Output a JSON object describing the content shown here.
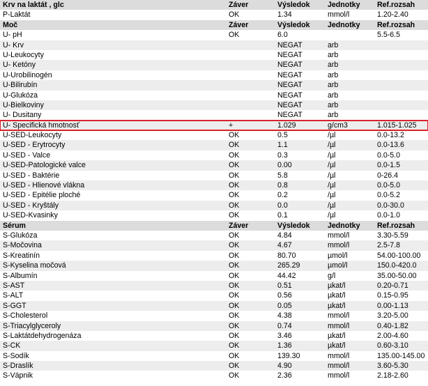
{
  "sections": [
    {
      "header": {
        "name": "Krv na laktát , glc",
        "zaver": "Záver",
        "vysledok": "Výsledok",
        "jednotky": "Jednotky",
        "ref": "Ref.rozsah"
      },
      "rows": [
        {
          "name": "P-Laktát",
          "zaver": "OK",
          "vysledok": "1.34",
          "jednotky": "mmol/l",
          "ref": "1.20-2.40"
        }
      ]
    },
    {
      "header": {
        "name": "Moč",
        "zaver": "Záver",
        "vysledok": "Výsledok",
        "jednotky": "Jednotky",
        "ref": "Ref.rozsah"
      },
      "rows": [
        {
          "name": "U- pH",
          "zaver": "OK",
          "vysledok": "6.0",
          "jednotky": "",
          "ref": "5.5-6.5"
        },
        {
          "name": "U- Krv",
          "zaver": "",
          "vysledok": "NEGAT",
          "jednotky": "arb",
          "ref": ""
        },
        {
          "name": "U-Leukocyty",
          "zaver": "",
          "vysledok": "NEGAT",
          "jednotky": "arb",
          "ref": ""
        },
        {
          "name": "U- Ketóny",
          "zaver": "",
          "vysledok": "NEGAT",
          "jednotky": "arb",
          "ref": ""
        },
        {
          "name": "U-Urobilinogén",
          "zaver": "",
          "vysledok": "NEGAT",
          "jednotky": "arb",
          "ref": ""
        },
        {
          "name": "U-Bilirubín",
          "zaver": "",
          "vysledok": "NEGAT",
          "jednotky": "arb",
          "ref": ""
        },
        {
          "name": "U-Glukóza",
          "zaver": "",
          "vysledok": "NEGAT",
          "jednotky": "arb",
          "ref": ""
        },
        {
          "name": "U-Bielkoviny",
          "zaver": "",
          "vysledok": "NEGAT",
          "jednotky": "arb",
          "ref": ""
        },
        {
          "name": "U- Dusitany",
          "zaver": "",
          "vysledok": "NEGAT",
          "jednotky": "arb",
          "ref": ""
        },
        {
          "name": "U- Specifická hmotnosť",
          "zaver": "+",
          "vysledok": "1.029",
          "jednotky": "g/cm3",
          "ref": "1.015-1.025",
          "highlight": true
        },
        {
          "name": "U-SED-Leukocyty",
          "zaver": "OK",
          "vysledok": "0.5",
          "jednotky": "/µl",
          "ref": "0.0-13.2"
        },
        {
          "name": "U-SED - Erytrocyty",
          "zaver": "OK",
          "vysledok": "1.1",
          "jednotky": "/µl",
          "ref": "0.0-13.6"
        },
        {
          "name": "U-SED - Valce",
          "zaver": "OK",
          "vysledok": "0.3",
          "jednotky": "/µl",
          "ref": "0.0-5.0"
        },
        {
          "name": "U-SED-Patologické valce",
          "zaver": "OK",
          "vysledok": "0.00",
          "jednotky": "/µl",
          "ref": "0.0-1.5"
        },
        {
          "name": "U-SED - Baktérie",
          "zaver": "OK",
          "vysledok": "5.8",
          "jednotky": "/µl",
          "ref": "0-26.4"
        },
        {
          "name": "U-SED - Hlienové vlákna",
          "zaver": "OK",
          "vysledok": "0.8",
          "jednotky": "/µl",
          "ref": "0.0-5.0"
        },
        {
          "name": "U-SED - Epitélie ploché",
          "zaver": "OK",
          "vysledok": "0.2",
          "jednotky": "/µl",
          "ref": "0.0-5.2"
        },
        {
          "name": "U-SED - Kryštály",
          "zaver": "OK",
          "vysledok": "0.0",
          "jednotky": "/µl",
          "ref": "0.0-30.0"
        },
        {
          "name": "U-SED-Kvasinky",
          "zaver": "OK",
          "vysledok": "0.1",
          "jednotky": "/µl",
          "ref": "0.0-1.0"
        }
      ]
    },
    {
      "header": {
        "name": "Sérum",
        "zaver": "Záver",
        "vysledok": "Výsledok",
        "jednotky": "Jednotky",
        "ref": "Ref.rozsah"
      },
      "rows": [
        {
          "name": "S-Glukóza",
          "zaver": "OK",
          "vysledok": "4.84",
          "jednotky": "mmol/l",
          "ref": "3.30-5.59"
        },
        {
          "name": "S-Močovina",
          "zaver": "OK",
          "vysledok": "4.67",
          "jednotky": "mmol/l",
          "ref": "2.5-7.8"
        },
        {
          "name": "S-Kreatinín",
          "zaver": "OK",
          "vysledok": "80.70",
          "jednotky": "µmol/l",
          "ref": "54.00-100.00"
        },
        {
          "name": "S-Kyselina močová",
          "zaver": "OK",
          "vysledok": "265.29",
          "jednotky": "µmol/l",
          "ref": "150.0-420.0"
        },
        {
          "name": "S-Albumín",
          "zaver": "OK",
          "vysledok": "44.42",
          "jednotky": "g/l",
          "ref": "35.00-50.00"
        },
        {
          "name": "S-AST",
          "zaver": "OK",
          "vysledok": "0.51",
          "jednotky": "µkat/l",
          "ref": "0.20-0.71"
        },
        {
          "name": "S-ALT",
          "zaver": "OK",
          "vysledok": "0.56",
          "jednotky": "µkat/l",
          "ref": "0.15-0.95"
        },
        {
          "name": "S-GGT",
          "zaver": "OK",
          "vysledok": "0.05",
          "jednotky": "µkat/l",
          "ref": "0.00-1.13"
        },
        {
          "name": "S-Cholesterol",
          "zaver": "OK",
          "vysledok": "4.38",
          "jednotky": "mmol/l",
          "ref": "3.20-5.00"
        },
        {
          "name": "S-Triacylglyceroly",
          "zaver": "OK",
          "vysledok": "0.74",
          "jednotky": "mmol/l",
          "ref": "0.40-1.82"
        },
        {
          "name": "S-Laktátdehydrogenáza",
          "zaver": "OK",
          "vysledok": "3.46",
          "jednotky": "µkat/l",
          "ref": "2.00-4.60"
        },
        {
          "name": "S-CK",
          "zaver": "OK",
          "vysledok": "1.36",
          "jednotky": "µkat/l",
          "ref": "0.60-3.10"
        },
        {
          "name": "S-Sodík",
          "zaver": "OK",
          "vysledok": "139.30",
          "jednotky": "mmol/l",
          "ref": "135.00-145.00"
        },
        {
          "name": "S-Draslík",
          "zaver": "OK",
          "vysledok": "4.90",
          "jednotky": "mmol/l",
          "ref": "3.60-5.30"
        },
        {
          "name": "S-Vápnik",
          "zaver": "OK",
          "vysledok": "2.36",
          "jednotky": "mmol/l",
          "ref": "2.18-2.60"
        }
      ]
    }
  ],
  "colors": {
    "header_bg": "#dcdcdc",
    "alt_row_bg": "#ededed",
    "highlight_border": "#d9232a"
  }
}
